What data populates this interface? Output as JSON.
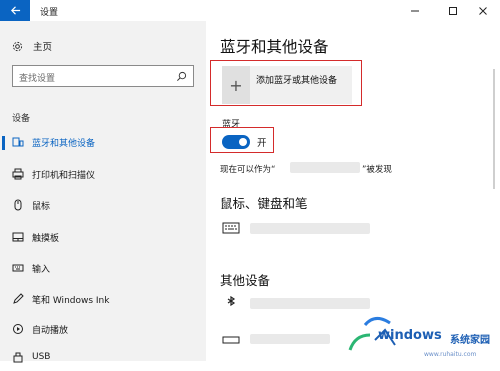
{
  "window": {
    "title": "设置"
  },
  "nav": {
    "home": "主页",
    "search_placeholder": "查找设置",
    "section": "设备",
    "items": [
      {
        "label": "蓝牙和其他设备",
        "icon": "bluetooth-devices-icon",
        "active": true
      },
      {
        "label": "打印机和扫描仪",
        "icon": "printer-icon"
      },
      {
        "label": "鼠标",
        "icon": "mouse-icon"
      },
      {
        "label": "触摸板",
        "icon": "touchpad-icon"
      },
      {
        "label": "输入",
        "icon": "keyboard-icon"
      },
      {
        "label": "笔和 Windows Ink",
        "icon": "pen-icon"
      },
      {
        "label": "自动播放",
        "icon": "autoplay-icon"
      },
      {
        "label": "USB",
        "icon": "usb-icon"
      }
    ]
  },
  "main": {
    "title": "蓝牙和其他设备",
    "add_device": "添加蓝牙或其他设备",
    "bluetooth_label": "蓝牙",
    "bluetooth_state": "开",
    "discoverable_prefix": "现在可以作为“",
    "discoverable_suffix": "”被发现",
    "section_mouse": "鼠标、键盘和笔",
    "section_other": "其他设备"
  },
  "watermark": {
    "brand": "windows",
    "cn": "系统家园",
    "url": "www.ruhaitu.com"
  },
  "colors": {
    "accent": "#0a64c2",
    "highlight": "#d42b2b"
  }
}
